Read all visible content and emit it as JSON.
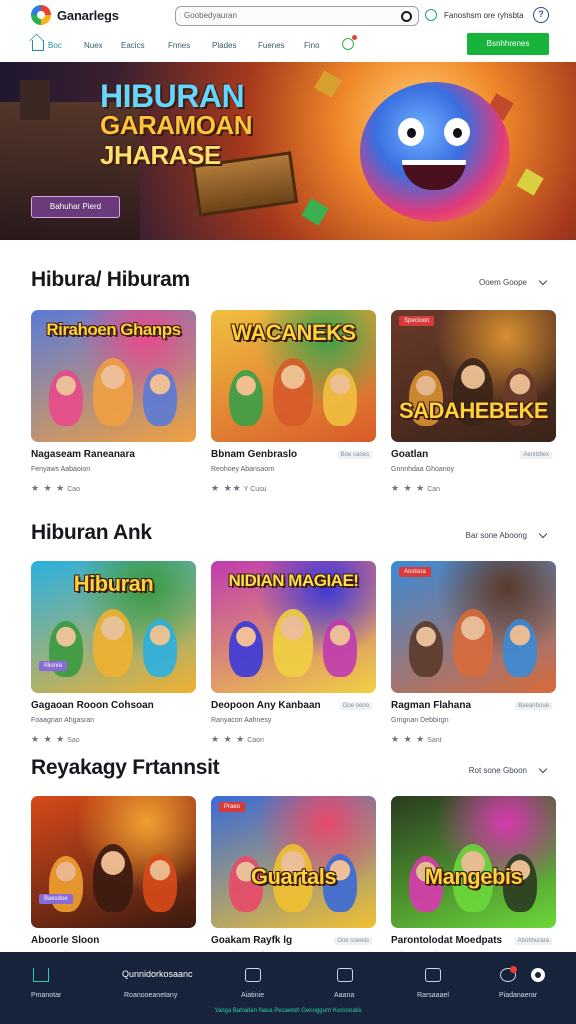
{
  "header": {
    "brand": "Ganarlegs",
    "search_placeholder": "Goobedyauran",
    "account_text": "Fanoshsm ore ryhsbta",
    "help_label": "?"
  },
  "nav": {
    "items": [
      "Boc",
      "Nuex",
      "Eacics",
      "Fnnes",
      "Plades",
      "Fuenes",
      "Fino"
    ],
    "cta_label": "Bsnhhrenes"
  },
  "hero": {
    "title_line1": "HIBURAN",
    "title_line2": "GARAMOAN",
    "title_line3": "JHARASE",
    "button_label": "Bahuhar Pierd"
  },
  "sections": [
    {
      "title": "Hibura/ Hiburam",
      "more_label": "Ooem Goope",
      "cards": [
        {
          "art_text": "Rirahoen Ghanps",
          "title": "Nagaseam Raneanara",
          "subtitle": "Fenyaws Aabaoion",
          "stars": "★ ★ ★",
          "count": "Cao",
          "badge": "",
          "colors": [
            "#5a7ad8",
            "#f0a040",
            "#e84a8a"
          ]
        },
        {
          "art_text": "WACANEKS",
          "title": "Bbnam Genbraslo",
          "subtitle": "Reohoey Abansaorn",
          "stars": "★ ★★",
          "count": "Y Cusu",
          "badge": "Boe saoes",
          "colors": [
            "#f0c040",
            "#d85a2a",
            "#3aa04a"
          ]
        },
        {
          "art_text": "SADAHEBEKE",
          "title": "Goatlan",
          "subtitle": "Gnnnhdaa Ghoanoy",
          "stars": "★ ★ ★",
          "count": "Can",
          "badge": "Aenrbbex",
          "colors": [
            "#6a3a2a",
            "#3a2418",
            "#d89030"
          ],
          "tag": "Spectoon"
        }
      ]
    },
    {
      "title": "Hiburan Ank",
      "more_label": "Bar sone Aboong",
      "cards": [
        {
          "art_text": "Hiburan",
          "title": "Gagaoan Rooon Cohsoan",
          "subtitle": "Foaagnan Ahgasran",
          "stars": "★ ★ ★",
          "count": "Sao",
          "badge": "",
          "colors": [
            "#2ab0e0",
            "#f0b030",
            "#3a9a40"
          ],
          "tag": "Mionre"
        },
        {
          "art_text": "NIDIAN MAGIAE!",
          "title": "Deopoon Any Kanbaan",
          "subtitle": "Ranyacon Aahnesy",
          "stars": "★ ★ ★",
          "count": "Caon",
          "badge": "Ooe oeoo",
          "colors": [
            "#c03ab0",
            "#f0d040",
            "#3a3ad8"
          ]
        },
        {
          "art_text": "",
          "title": "Ragman Flahana",
          "subtitle": "Grngnan Debbirgn",
          "stars": "★ ★ ★",
          "count": "Sant",
          "badge": "Baeanboue",
          "colors": [
            "#3a8ad8",
            "#d86a3a",
            "#5a3a2a"
          ],
          "tag": "Aostsoa"
        }
      ]
    },
    {
      "title": "Reyakagy Frtannsit",
      "more_label": "Rot sone Gboon",
      "cards": [
        {
          "art_text": "",
          "title": "Aboorle Sloon",
          "subtitle": "Gaasang Ahrarao",
          "stars": "",
          "count": "",
          "badge": "",
          "colors": [
            "#d84a1a",
            "#3a1a10",
            "#f0a030"
          ],
          "tag": "Baesdoe"
        },
        {
          "art_text": "Guartals",
          "title": "Goakam Rayfk lg",
          "subtitle": "Rarnonkon Garnia",
          "stars": "",
          "count": "",
          "badge": "Ooe soeeiis",
          "colors": [
            "#3a6ad8",
            "#f0c030",
            "#e84a6a"
          ],
          "tag": "Praeo"
        },
        {
          "art_text": "Mangebis",
          "title": "Parontolodat Moedpats",
          "subtitle": "Gohpgen Hanboanesaa",
          "stars": "",
          "count": "",
          "badge": "Abohhurara",
          "colors": [
            "#2a3a20",
            "#6ad83a",
            "#d83ab0"
          ]
        }
      ]
    }
  ],
  "bottom_nav": {
    "center_text": "Qunnidorkosaanc",
    "items": [
      "Pmanotar",
      "Roanooeanetany",
      "Aiatinie",
      "Aaana",
      "Rarsaaael",
      "Piadanaerar"
    ],
    "footer": "Yanga Bahadan Nasa Pesaetoh Genoggurn Koronoatis"
  }
}
